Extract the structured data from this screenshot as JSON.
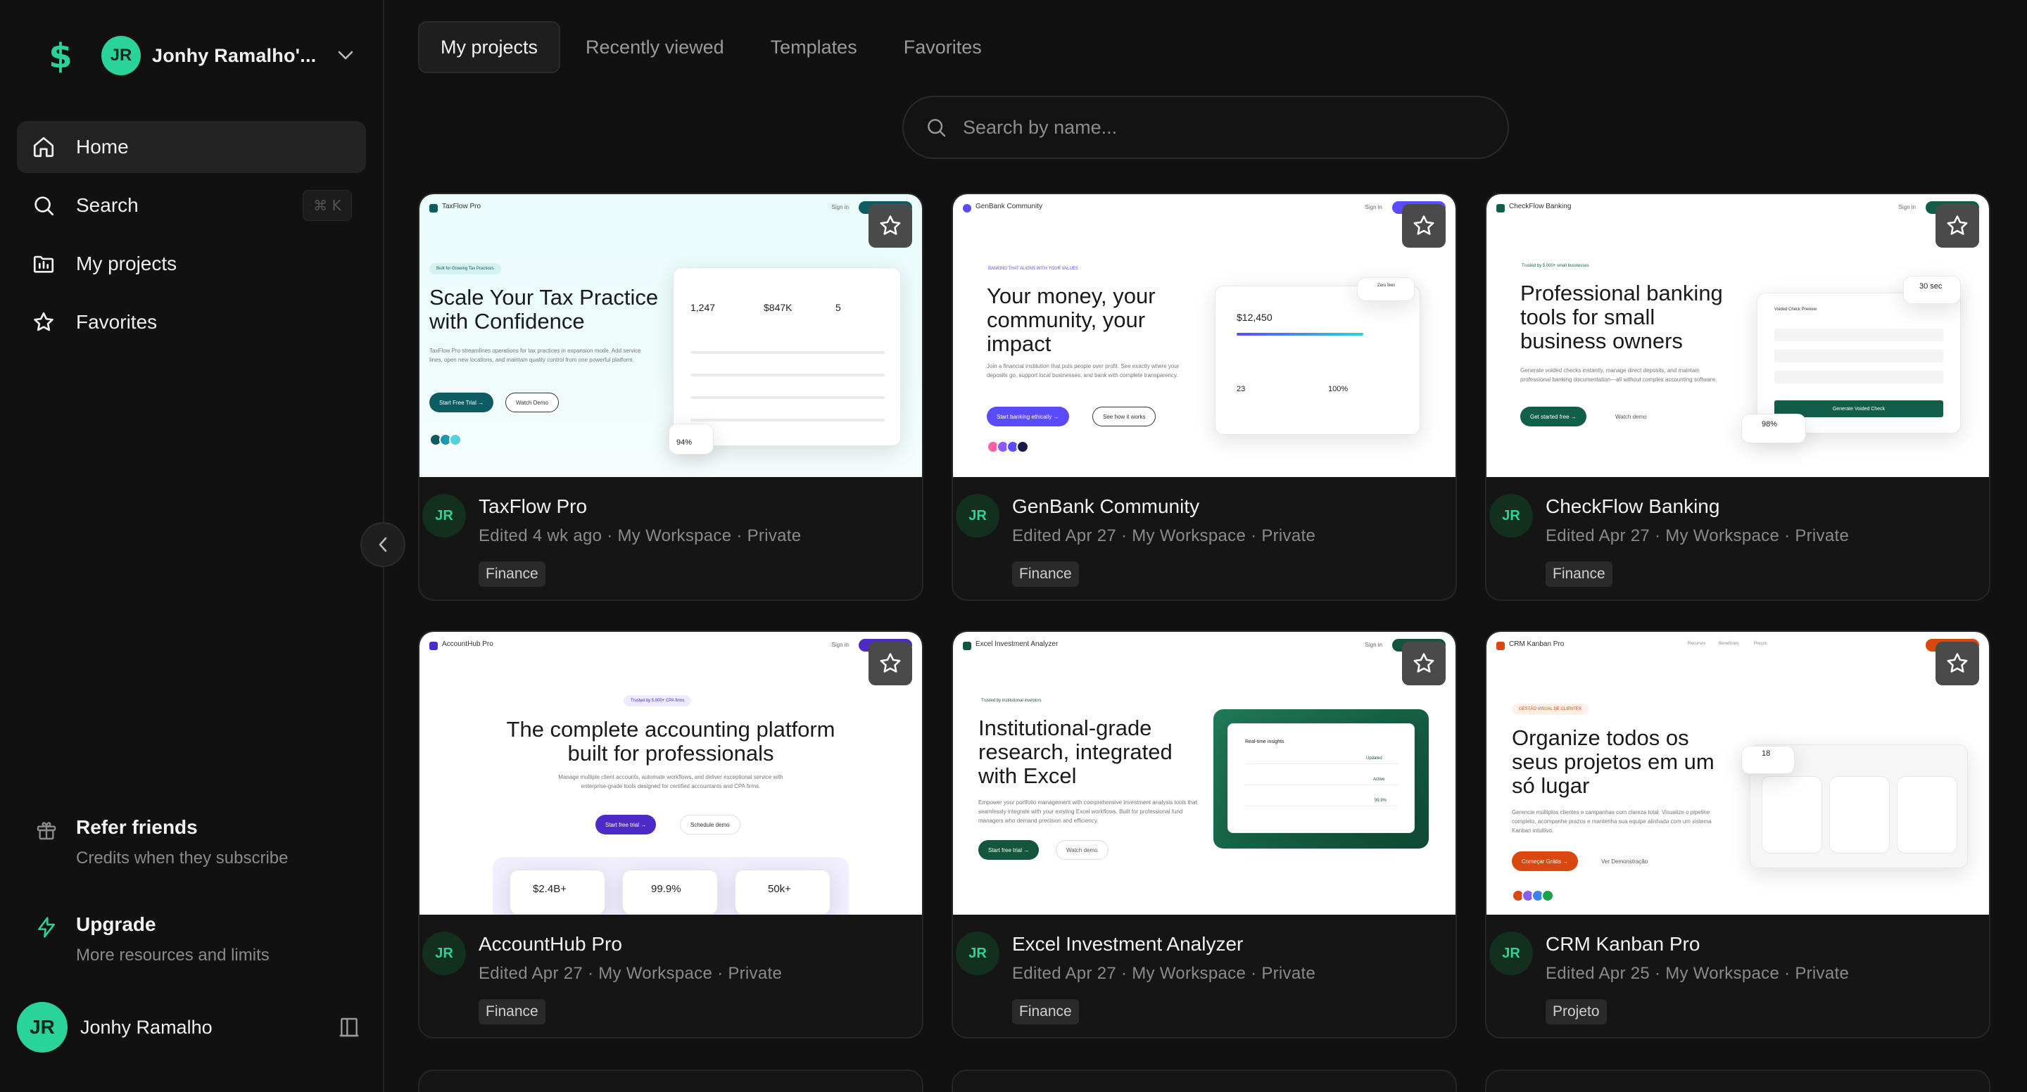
{
  "workspace": {
    "initials": "JR",
    "name": "Jonhy Ramalho'..."
  },
  "nav": {
    "home": "Home",
    "search": "Search",
    "search_shortcut": "⌘ K",
    "projects": "My projects",
    "favorites": "Favorites"
  },
  "promos": {
    "refer_title": "Refer friends",
    "refer_sub": "Credits when they subscribe",
    "upgrade_title": "Upgrade",
    "upgrade_sub": "More resources and limits"
  },
  "user": {
    "initials": "JR",
    "name": "Jonhy Ramalho"
  },
  "tabs": [
    "My projects",
    "Recently viewed",
    "Templates",
    "Favorites"
  ],
  "search": {
    "placeholder": "Search by name..."
  },
  "projects": [
    {
      "initials": "JR",
      "name": "TaxFlow Pro",
      "meta": "Edited 4 wk ago · My Workspace · Private",
      "tag": "Finance",
      "thumb": {
        "brand": "TaxFlow Pro",
        "headline": "Scale Your Tax Practice with Confidence",
        "badge": "Built for Growing Tax Practices",
        "cta": "Start Free Trial →",
        "cta2": "Watch Demo",
        "stat1": "1,247",
        "stat2": "$847K",
        "stat3": "5",
        "stat4": "94%",
        "accent": "#0d5c63"
      }
    },
    {
      "initials": "JR",
      "name": "GenBank Community",
      "meta": "Edited Apr 27 · My Workspace · Private",
      "tag": "Finance",
      "thumb": {
        "brand": "GenBank Community",
        "headline": "Your money, your community, your impact",
        "badge": "BANKING THAT ALIGNS WITH YOUR VALUES",
        "cta": "Start banking ethically →",
        "cta2": "See how it works",
        "stat1": "$12,450",
        "stat2": "23",
        "stat3": "100%",
        "stat4": "Zero fees",
        "accent": "#5b4bff"
      }
    },
    {
      "initials": "JR",
      "name": "CheckFlow Banking",
      "meta": "Edited Apr 27 · My Workspace · Private",
      "tag": "Finance",
      "thumb": {
        "brand": "CheckFlow Banking",
        "headline": "Professional banking tools for small business owners",
        "badge": "Trusted by 5,000+ small businesses",
        "cta": "Get started free →",
        "cta2": "Watch demo",
        "stat1": "30 sec",
        "stat2": "98%",
        "stat3": "Voided Check Preview",
        "stat4": "Generate Voided Check",
        "accent": "#115e4a"
      }
    },
    {
      "initials": "JR",
      "name": "AccountHub Pro",
      "meta": "Edited Apr 27 · My Workspace · Private",
      "tag": "Finance",
      "thumb": {
        "brand": "AccountHub Pro",
        "headline": "The complete accounting platform built for professionals",
        "badge": "Trusted by 5,000+ CPA firms",
        "cta": "Start free trial →",
        "cta2": "Schedule demo",
        "stat1": "$2.4B+",
        "stat2": "99.9%",
        "stat3": "50k+",
        "stat4": "",
        "accent": "#4c2bc7"
      }
    },
    {
      "initials": "JR",
      "name": "Excel Investment Analyzer",
      "meta": "Edited Apr 27 · My Workspace · Private",
      "tag": "Finance",
      "thumb": {
        "brand": "Excel Investment Analyzer",
        "headline": "Institutional-grade research, integrated with Excel",
        "badge": "Trusted by institutional investors",
        "cta": "Start free trial →",
        "cta2": "Watch demo",
        "stat1": "Real-time insights",
        "stat2": "Updated",
        "stat3": "Active",
        "stat4": "99.9%",
        "accent": "#14553e"
      }
    },
    {
      "initials": "JR",
      "name": "CRM Kanban Pro",
      "meta": "Edited Apr 25 · My Workspace · Private",
      "tag": "Projeto",
      "thumb": {
        "brand": "CRM Kanban Pro",
        "headline": "Organize todos os seus projetos em um só lugar",
        "badge": "GESTÃO VISUAL DE CLIENTES",
        "cta": "Começar Grátis →",
        "cta2": "Ver Demonstração",
        "stat1": "18",
        "stat2": "Recursos",
        "stat3": "Benefícios",
        "stat4": "Preços",
        "accent": "#d9480f"
      }
    }
  ],
  "colors": {
    "accent": "#2ad39a",
    "bg": "#111111",
    "card": "#151515"
  }
}
